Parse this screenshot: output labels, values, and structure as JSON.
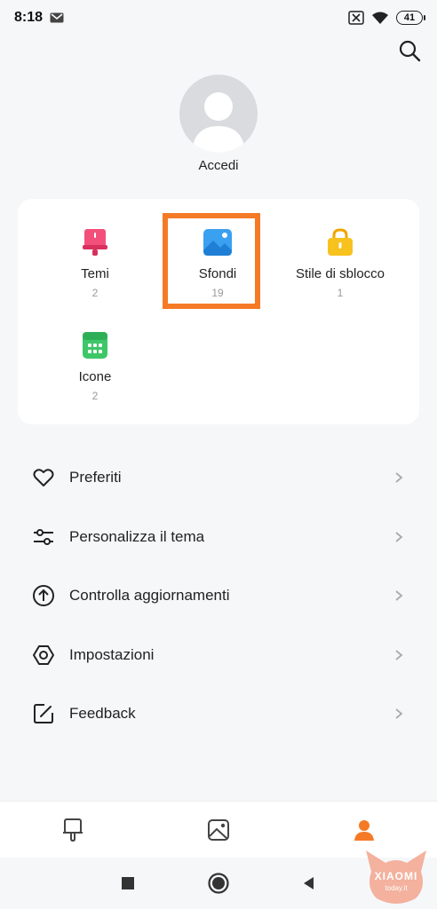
{
  "status_bar": {
    "time": "8:18",
    "battery": "41"
  },
  "profile": {
    "login_label": "Accedi"
  },
  "categories": [
    {
      "label": "Temi",
      "count": "2",
      "icon": "theme-brush-icon",
      "color": "#f24f7a"
    },
    {
      "label": "Sfondi",
      "count": "19",
      "icon": "wallpaper-image-icon",
      "color": "#3aa0f0"
    },
    {
      "label": "Stile di sblocco",
      "count": "1",
      "icon": "lock-style-icon",
      "color": "#f7b91e"
    },
    {
      "label": "Icone",
      "count": "2",
      "icon": "icon-grid-icon",
      "color": "#3dc768"
    }
  ],
  "menu": [
    {
      "label": "Preferiti",
      "icon": "heart-icon"
    },
    {
      "label": "Personalizza il tema",
      "icon": "sliders-icon"
    },
    {
      "label": "Controlla aggiornamenti",
      "icon": "arrow-up-circle-icon"
    },
    {
      "label": "Impostazioni",
      "icon": "settings-icon"
    },
    {
      "label": "Feedback",
      "icon": "edit-icon"
    }
  ],
  "tabs": [
    {
      "icon": "themes-tab-icon",
      "active": false
    },
    {
      "icon": "wallpapers-tab-icon",
      "active": false
    },
    {
      "icon": "profile-tab-icon",
      "active": true
    }
  ],
  "colors": {
    "accent": "#f57a26",
    "highlight_border": "#f57a26"
  },
  "watermark": {
    "brand": "XIAOMI",
    "site": "today.it"
  }
}
